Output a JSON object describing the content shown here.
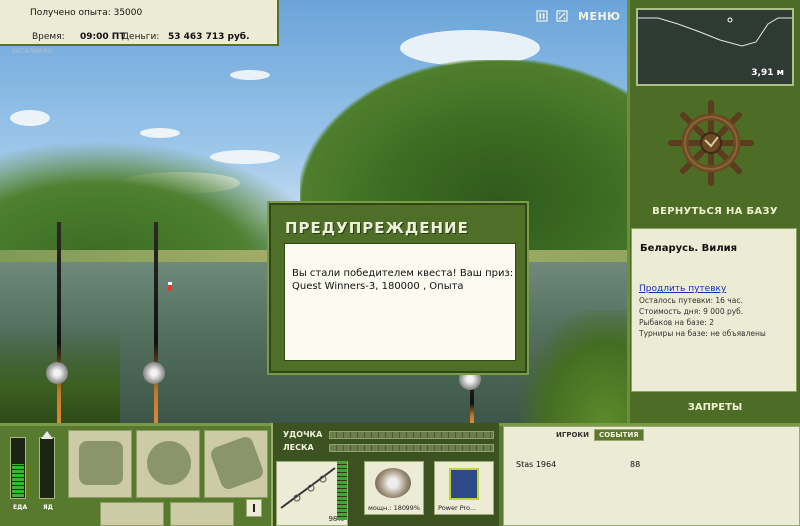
{
  "hud": {
    "experience_label": "Получено опыта: 35000",
    "time_label": "Время:",
    "time_value": "09:00 ПТ",
    "money_label": "Деньги:",
    "money_value": "53 463 713 руб.",
    "logo_text": "ВИТАЛИЙ.RU"
  },
  "top_controls": {
    "pause_icon": "pause-icon",
    "settings_icon": "settings-icon",
    "menu_label": "МЕНЮ"
  },
  "sidebar": {
    "depth_value": "3,91 м",
    "return_label": "ВЕРНУТЬСЯ НА БАЗУ",
    "base_name": "Беларусь. Вилия",
    "extend_link": "Продлить путевку",
    "details": [
      "Осталось путевки: 16 час.",
      "Стоимость дня: 9 000 руб.",
      "Рыбаков на базе: 2",
      "Турниры на базе: не объявлены"
    ],
    "bans_label": "ЗАПРЕТЫ"
  },
  "status": {
    "eda_label": "ЕДА",
    "yad_label": "ЯД",
    "eda_level": 0.55,
    "yad_level": 0
  },
  "tackle": {
    "rod_label": "УДОЧКА",
    "line_label": "ЛЕСКА",
    "rod_percent": "98%",
    "rod_level": 0.98,
    "items": [
      {
        "caption": "мощн.: 180",
        "percent": "99%"
      },
      {
        "caption": "Power Pro...",
        "percent": ""
      }
    ]
  },
  "players_panel": {
    "tab_players": "ИГРОКИ",
    "tab_events": "СОБЫТИЯ",
    "rows": [
      {
        "name": "Stas 1964",
        "score": "88"
      }
    ]
  },
  "modal": {
    "title": "ПРЕДУПРЕЖДЕНИЕ",
    "text": "Вы стали победителем квеста! Ваш приз: Quest Winners-3, 180000 , Опыта"
  }
}
